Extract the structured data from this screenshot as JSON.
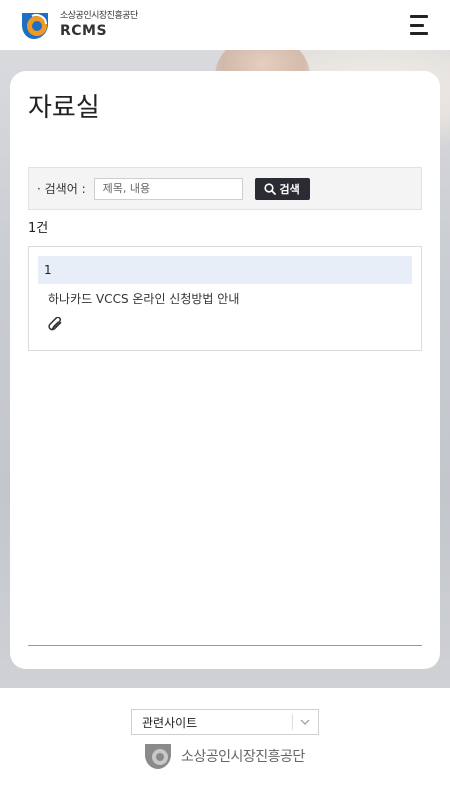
{
  "header": {
    "org_name": "소상공인시장진흥공단",
    "system_name": "RCMS"
  },
  "page": {
    "title": "자료실"
  },
  "search": {
    "label": "· 검색어 :",
    "placeholder": "제목, 내용",
    "button_label": "검색"
  },
  "results": {
    "count_text": "1건",
    "items": [
      {
        "number": "1",
        "title": "하나카드 VCCS 온라인 신청방법 안내",
        "has_attachment": true
      }
    ]
  },
  "footer": {
    "related_sites_label": "관련사이트",
    "org_name": "소상공인시장진흥공단"
  },
  "colors": {
    "brand_blue": "#1e6fc4",
    "brand_orange": "#f29a1f",
    "search_button": "#2b2b33",
    "row_highlight": "#e8eef7"
  },
  "icons": {
    "menu": "hamburger-menu-icon",
    "search": "magnifier-icon",
    "attachment": "paperclip-icon",
    "dropdown": "chevron-down-icon"
  }
}
